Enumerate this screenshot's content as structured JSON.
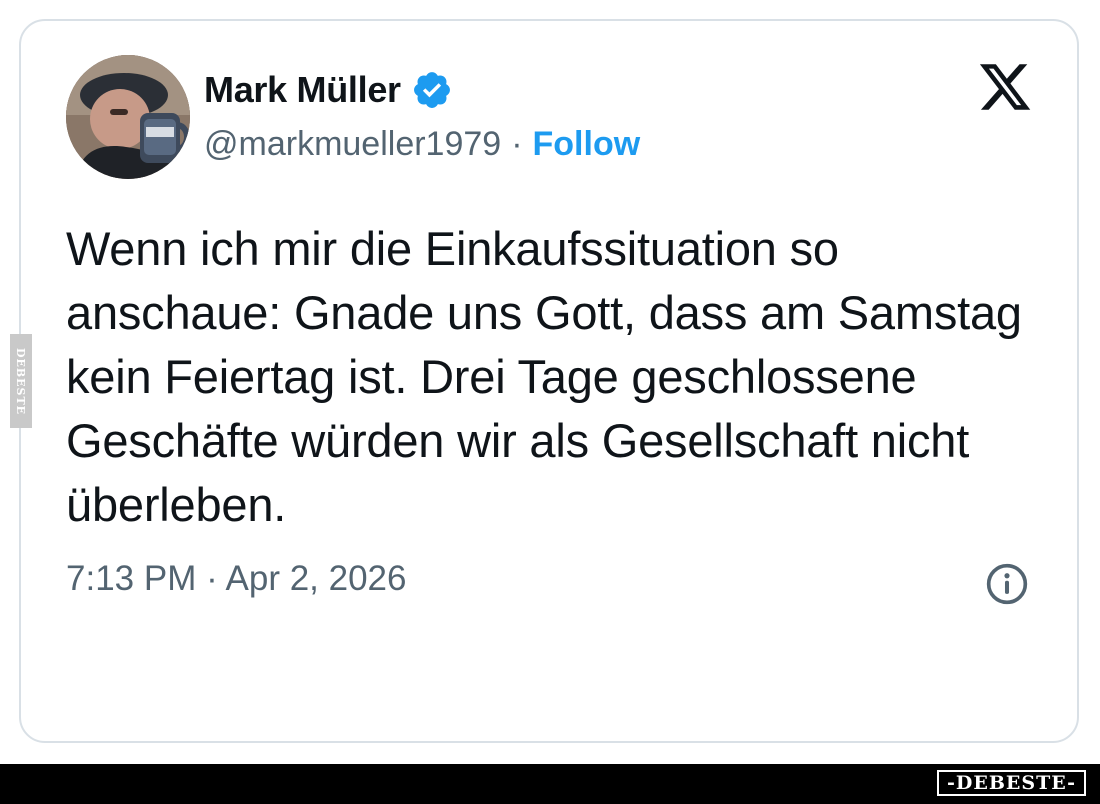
{
  "tweet": {
    "author": {
      "display_name": "Mark Müller",
      "handle": "@markmueller1979",
      "verified": true,
      "avatar_icon": "user-avatar-photo"
    },
    "separator": "·",
    "follow_label": "Follow",
    "text": "Wenn ich mir die Einkaufssituation so anschaue: Gnade uns Gott, dass am Samstag kein Feiertag ist. Drei Tage geschlossene Geschäfte würden wir als Gesellschaft nicht überleben.",
    "timestamp": "7:13 PM · Apr 2, 2026",
    "platform_icon": "x-logo-icon",
    "info_icon": "info-icon"
  },
  "watermark": {
    "side_text": "DEBESTE",
    "bottom_text": "-DEBESTE-"
  },
  "colors": {
    "text_primary": "#0f1419",
    "text_secondary": "#536471",
    "accent": "#1d9bf0",
    "card_border": "#d9e0e6",
    "bottom_bar": "#000000"
  }
}
